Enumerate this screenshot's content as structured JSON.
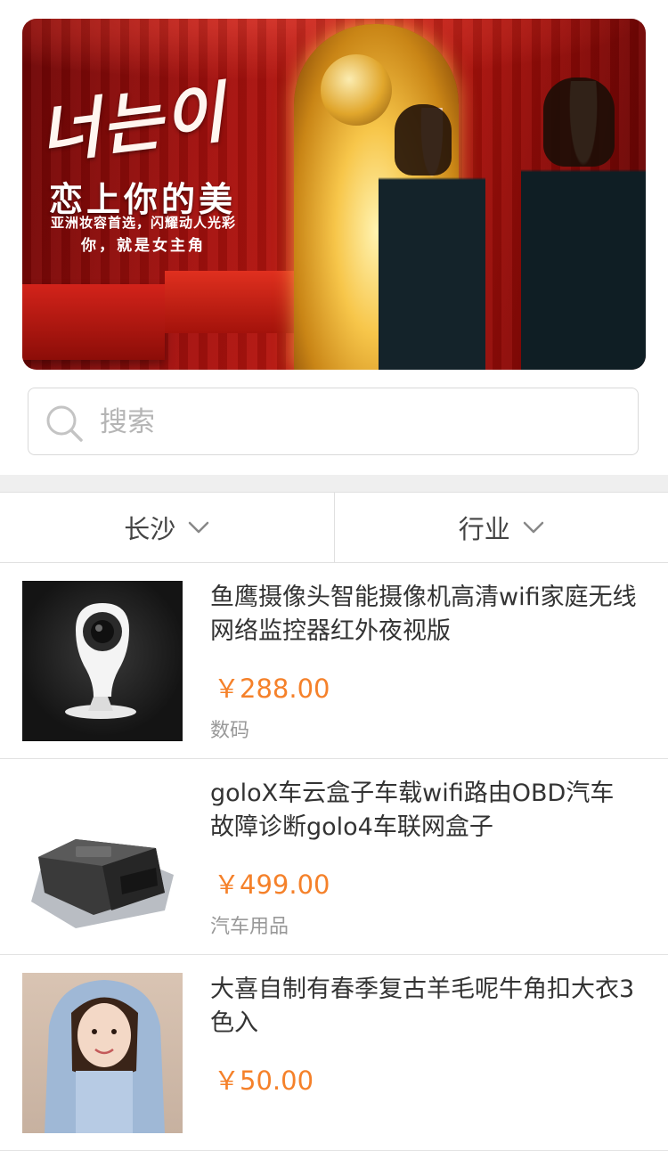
{
  "banner": {
    "hangul_text": "너는이",
    "slogan": "恋上你的美",
    "subline1": "亚洲妆容首选，闪耀动人光彩",
    "subline2": "你，就是女主角"
  },
  "search": {
    "placeholder": "搜索"
  },
  "filters": [
    {
      "label": "长沙",
      "icon": "chevron-down-icon"
    },
    {
      "label": "行业",
      "icon": "chevron-down-icon"
    }
  ],
  "products": [
    {
      "title": "鱼鹰摄像头智能摄像机高清wifi家庭无线网络监控器红外夜视版",
      "price": "￥288.00",
      "category": "数码",
      "image": "security-camera"
    },
    {
      "title": "goloX车云盒子车载wifi路由OBD汽车故障诊断golo4车联网盒子",
      "price": "￥499.00",
      "category": "汽车用品",
      "image": "obd-box"
    },
    {
      "title": "大喜自制有春季复古羊毛呢牛角扣大衣3色入",
      "price": "￥50.00",
      "category": "",
      "image": "woman-in-blue-coat"
    }
  ],
  "colors": {
    "price": "#f5812a",
    "divider": "#e0e0e0",
    "section_gap": "#efefef"
  }
}
